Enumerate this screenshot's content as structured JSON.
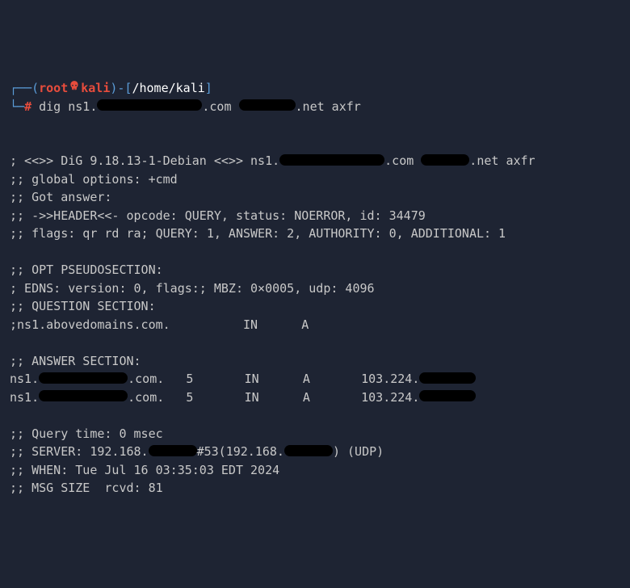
{
  "prompt": {
    "open": "┌──(",
    "user": "root",
    "host": "kali",
    "close1": ")-[",
    "path": "/home/kali",
    "close2": "]",
    "line2_prefix": "└─",
    "hash": "#",
    "cmd_dig": "dig ns1.",
    "cmd_com": ".com ",
    "cmd_net": ".net axfr"
  },
  "out": {
    "ver_pre": "; <<>> DiG 9.18.13-1-Debian <<>> ns1.",
    "ver_com": ".com ",
    "ver_net": ".net axfr",
    "global": ";; global options: +cmd",
    "got": ";; Got answer:",
    "header": ";; ->>HEADER<<- opcode: QUERY, status: NOERROR, id: 34479",
    "flags": ";; flags: qr rd ra; QUERY: 1, ANSWER: 2, AUTHORITY: 0, ADDITIONAL: 1",
    "opt": ";; OPT PSEUDOSECTION:",
    "edns": "; EDNS: version: 0, flags:; MBZ: 0×0005, udp: 4096",
    "question": ";; QUESTION SECTION:",
    "q1": ";ns1.abovedomains.com.          IN      A",
    "answer": ";; ANSWER SECTION:",
    "a1_pre": "ns1.",
    "a1_mid": ".com.   5       IN      A       103.224.",
    "a2_pre": "ns1.",
    "a2_mid": ".com.   5       IN      A       103.224.",
    "qtime": ";; Query time: 0 msec",
    "server_pre": ";; SERVER: 192.168.",
    "server_mid": "#53(192.168.",
    "server_end": ") (UDP)",
    "when": ";; WHEN: Tue Jul 16 03:35:03 EDT 2024",
    "msgsize": ";; MSG SIZE  rcvd: 81"
  }
}
